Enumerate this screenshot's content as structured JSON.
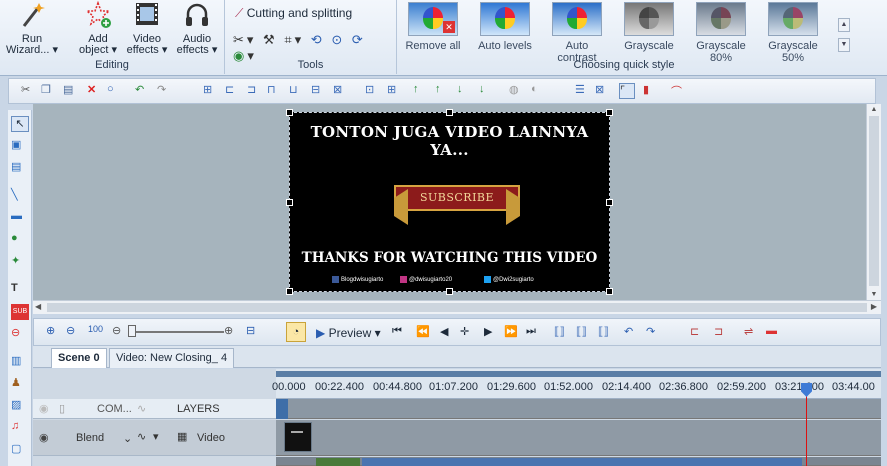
{
  "ribbon": {
    "editing": {
      "label": "Editing",
      "run_wizard": [
        "Run",
        "Wizard..."
      ],
      "add_object": [
        "Add",
        "object"
      ],
      "video_effects": [
        "Video",
        "effects"
      ],
      "audio_effects": [
        "Audio",
        "effects"
      ]
    },
    "tools": {
      "label": "Tools",
      "cutting": "Cutting and splitting"
    },
    "quick_style": {
      "label": "Choosing quick style",
      "items": [
        "Remove all",
        "Auto levels",
        "Auto contrast",
        "Grayscale",
        "Grayscale 80%",
        "Grayscale 50%"
      ]
    }
  },
  "video": {
    "title": "TONTON JUGA VIDEO LAINNYA YA...",
    "subscribe": "SUBSCRIBE",
    "thanks": "THANKS FOR WATCHING THIS VIDEO",
    "social": [
      "Blogdwisugiarto",
      "@dwisugiarto20",
      "@Dwi2sugiarto"
    ]
  },
  "timeline_toolbar": {
    "preview": "Preview"
  },
  "tabs": [
    "Scene 0",
    "Video: New Closing_ 4"
  ],
  "timeline": {
    "ticks": [
      "00.000",
      "00:22.400",
      "00:44.800",
      "01:07.200",
      "01:29.600",
      "01:52.000",
      "02:14.400",
      "02:36.800",
      "02:59.200",
      "03:21.600",
      "03:44.00"
    ],
    "header": {
      "com": "COM...",
      "layers": "LAYERS"
    },
    "track": {
      "blend": "Blend",
      "type": "Video"
    }
  }
}
